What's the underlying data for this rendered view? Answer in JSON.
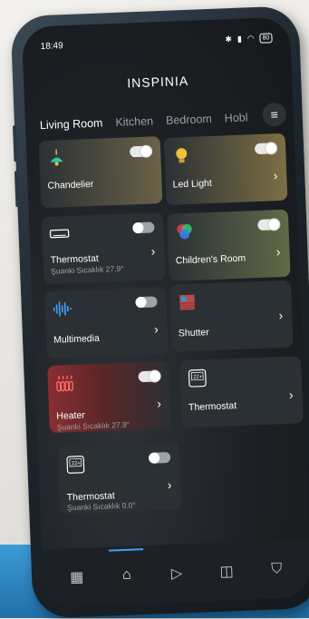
{
  "status": {
    "time": "18:49",
    "battery": "80"
  },
  "brand": {
    "logo": "INSPINIA"
  },
  "tabs": [
    {
      "label": "Living Room",
      "active": true
    },
    {
      "label": "Kitchen",
      "active": false
    },
    {
      "label": "Bedroom",
      "active": false
    },
    {
      "label": "Hobl",
      "active": false
    }
  ],
  "devices": [
    {
      "title": "Chandelier",
      "subtitle": "",
      "toggle": "on",
      "arrow": false,
      "icon": "ceiling-lamp-icon"
    },
    {
      "title": "Led Light",
      "subtitle": "",
      "toggle": "on",
      "arrow": true,
      "icon": "light-bulb-icon"
    },
    {
      "title": "Thermostat",
      "subtitle": "Şuanki Sıcaklık 27.9°",
      "toggle": "on",
      "arrow": true,
      "icon": "air-conditioner-icon"
    },
    {
      "title": "Children's Room",
      "subtitle": "",
      "toggle": "on",
      "arrow": true,
      "icon": "rgb-light-icon"
    },
    {
      "title": "Multimedia",
      "subtitle": "",
      "toggle": "on",
      "arrow": true,
      "icon": "audio-wave-icon"
    },
    {
      "title": "Shutter",
      "subtitle": "",
      "toggle": null,
      "arrow": true,
      "icon": "shutter-icon"
    },
    {
      "title": "Heater",
      "subtitle": "Şuanki Sıcaklık 27.9°",
      "toggle": "on",
      "arrow": true,
      "icon": "heater-icon"
    },
    {
      "title": "Thermostat",
      "subtitle": "",
      "toggle": null,
      "arrow": true,
      "icon": "thermostat-display-icon"
    },
    {
      "title": "Thermostat",
      "subtitle": "Şuanki Sıcaklık 0.0°",
      "toggle": "on",
      "arrow": true,
      "icon": "thermostat-display-icon"
    }
  ],
  "thermostat_display": "22+",
  "nav": [
    "dashboard-icon",
    "home-icon",
    "play-icon",
    "camera-icon",
    "shield-icon"
  ]
}
